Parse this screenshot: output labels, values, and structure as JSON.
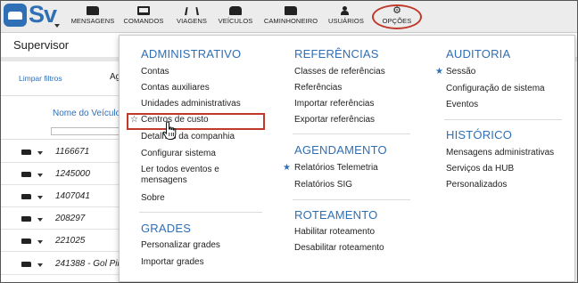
{
  "logo": {
    "text": "Sv"
  },
  "nav": [
    {
      "label": "MENSAGENS",
      "icon": "truck-icon"
    },
    {
      "label": "COMANDOS",
      "icon": "monitor-icon"
    },
    {
      "label": "VIAGENS",
      "icon": "road-icon"
    },
    {
      "label": "VEÍCULOS",
      "icon": "car-icon"
    },
    {
      "label": "CAMINHONEIRO",
      "icon": "truck-icon"
    },
    {
      "label": "USUÁRIOS",
      "icon": "user-icon"
    },
    {
      "label": "OPÇÕES",
      "icon": "gears-icon"
    }
  ],
  "page": {
    "title": "Supervisor",
    "limpar": "Limpar filtros",
    "fragment": "Ag",
    "column_header": "Nome do Veículo",
    "vehicles": [
      "1166671",
      "1245000",
      "1407041",
      "208297",
      "221025",
      "241388 - Gol Pir"
    ]
  },
  "menu": {
    "administrativo": {
      "title": "ADMINISTRATIVO",
      "items": [
        "Contas",
        "Contas auxiliares",
        "Unidades administrativas",
        "Centros de custo",
        "Detalhes da companhia",
        "Configurar sistema",
        "Ler todos eventos e mensagens",
        "Sobre"
      ]
    },
    "grades": {
      "title": "GRADES",
      "items": [
        "Personalizar grades",
        "Importar grades"
      ]
    },
    "referencias": {
      "title": "REFERÊNCIAS",
      "items": [
        "Classes de referências",
        "Referências",
        "Importar referências",
        "Exportar referências"
      ]
    },
    "agendamento": {
      "title": "AGENDAMENTO",
      "items": [
        "Relatórios Telemetria",
        "Relatórios SIG"
      ]
    },
    "roteamento": {
      "title": "ROTEAMENTO",
      "items": [
        "Habilitar roteamento",
        "Desabilitar roteamento"
      ]
    },
    "auditoria": {
      "title": "AUDITORIA",
      "items": [
        "Sessão",
        "Configuração de sistema",
        "Eventos"
      ]
    },
    "historico": {
      "title": "HISTÓRICO",
      "items": [
        "Mensagens administrativas",
        "Serviços da HUB",
        "Personalizados"
      ]
    }
  },
  "colors": {
    "accent": "#2f6fb5",
    "highlight": "#c0392b"
  }
}
